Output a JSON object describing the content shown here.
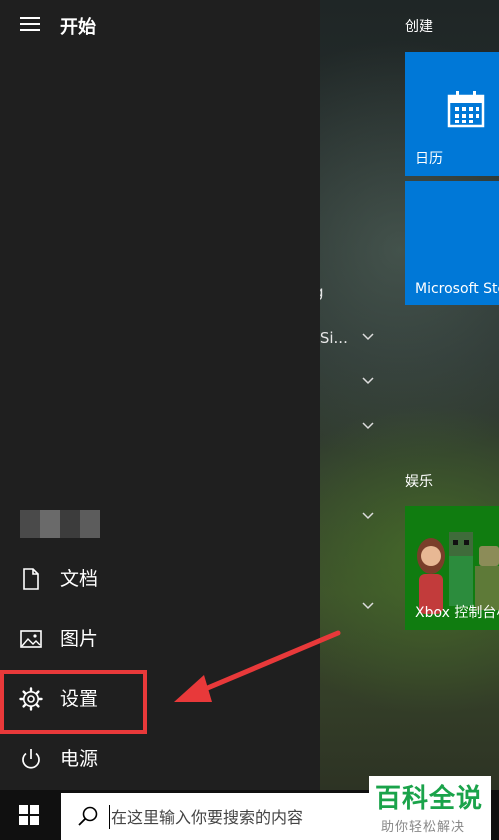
{
  "start": {
    "title": "开始"
  },
  "nav": {
    "documents": "文档",
    "pictures": "图片",
    "settings": "设置",
    "power": "电源"
  },
  "partial_list": {
    "item1": "g",
    "item2": "(Si..."
  },
  "tiles": {
    "create_group": "创建",
    "entertainment_group": "娱乐",
    "calendar": "日历",
    "store": "Microsoft Store",
    "xbox": "Xbox 控制台小..."
  },
  "taskbar": {
    "search_placeholder": "在这里输入你要搜索的内容"
  },
  "watermark": {
    "main": "百科全说",
    "sub": "助你轻松解决"
  },
  "colors": {
    "tile_blue": "#0078d7",
    "panel": "#1f1f1f",
    "highlight": "#e8393a",
    "watermark_green": "#1aa34a"
  }
}
